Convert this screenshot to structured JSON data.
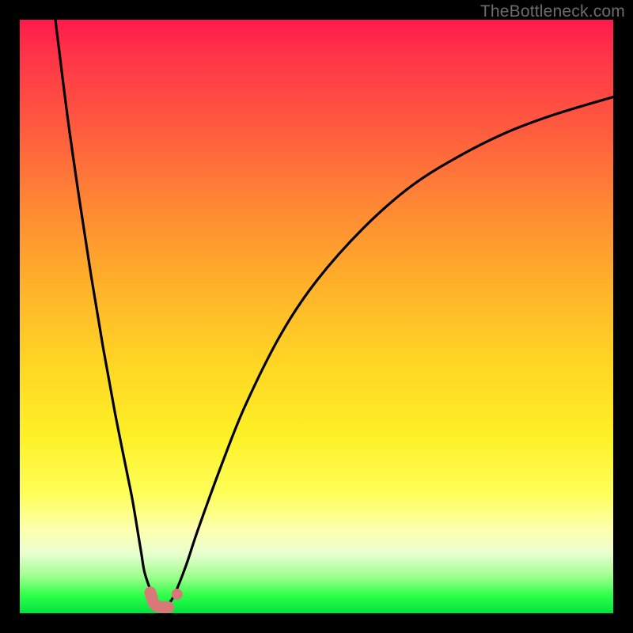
{
  "watermark": "TheBottleneck.com",
  "chart_data": {
    "type": "line",
    "title": "",
    "xlabel": "",
    "ylabel": "",
    "xlim": [
      0,
      100
    ],
    "ylim": [
      0,
      100
    ],
    "grid": false,
    "series": [
      {
        "name": "left-branch",
        "x": [
          6,
          8,
          10,
          12,
          14,
          16,
          18,
          19,
          20,
          20.5,
          21,
          22,
          23,
          23.5
        ],
        "y": [
          100,
          84,
          70,
          57,
          45,
          34,
          24,
          19,
          13,
          10,
          7,
          4,
          2,
          1.5
        ]
      },
      {
        "name": "right-branch",
        "x": [
          25,
          26,
          28,
          30,
          34,
          38,
          44,
          50,
          58,
          66,
          74,
          82,
          90,
          100
        ],
        "y": [
          1.5,
          3,
          8,
          14,
          25,
          35,
          47,
          56,
          65,
          72,
          77,
          81,
          84,
          87
        ]
      },
      {
        "name": "bottom-marker",
        "x": [
          22,
          22.5,
          23,
          24,
          25,
          25.5,
          26.5
        ],
        "y": [
          3.5,
          1.8,
          1.2,
          1.0,
          1.0,
          1.6,
          3.2
        ]
      }
    ],
    "colors": {
      "curve": "#000000",
      "marker": "#d77a77",
      "gradient_top": "#ff1a4d",
      "gradient_bottom": "#00e23e"
    }
  }
}
